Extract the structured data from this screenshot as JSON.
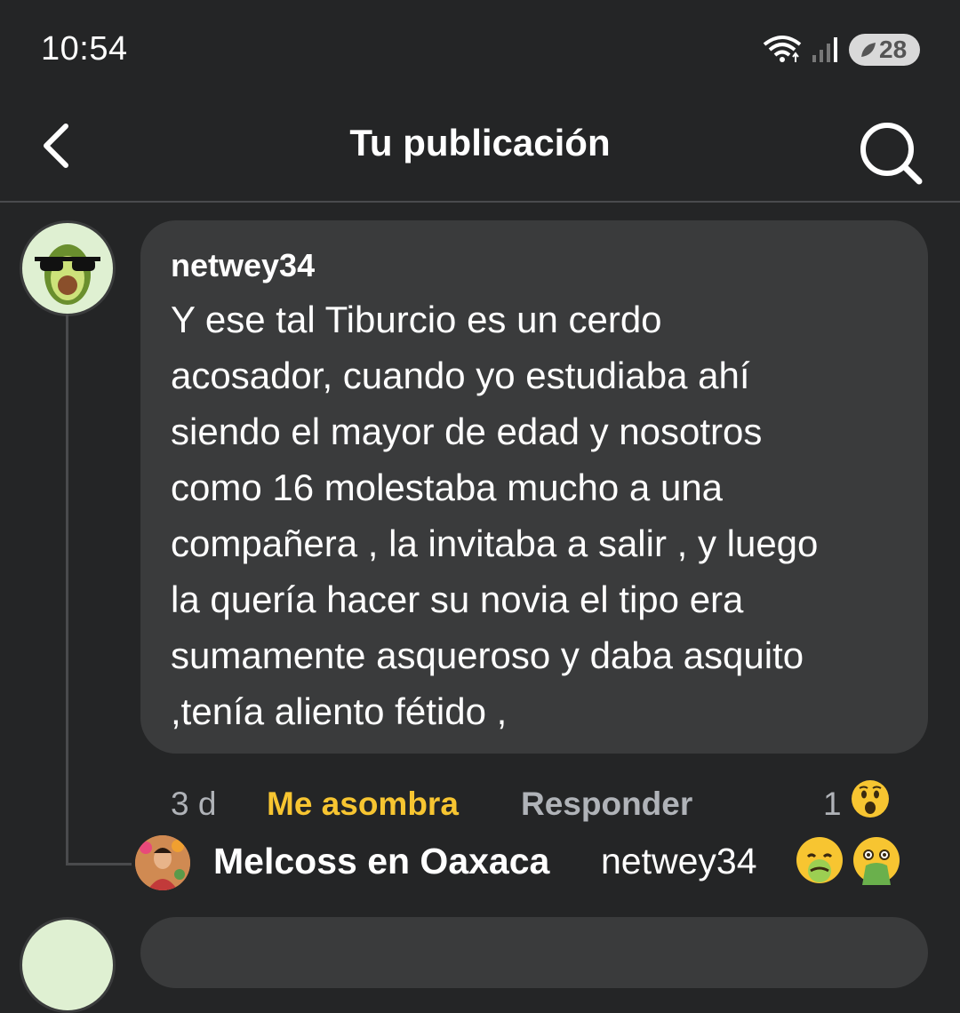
{
  "status_bar": {
    "time": "10:54",
    "battery": "28"
  },
  "header": {
    "title": "Tu publicación"
  },
  "comment": {
    "username": "netwey34",
    "text": "Y ese tal Tiburcio es un cerdo\nacosador, cuando yo estudiaba ahí\nsiendo el mayor de edad   y nosotros\ncomo 16 molestaba mucho a una\ncompañera , la invitaba a salir , y luego\nla quería hacer su novia el tipo era\nsumamente asqueroso y daba asquito\n,tenía aliento fétido ,",
    "time_ago": "3 d",
    "reaction_label": "Me asombra",
    "reply_label": "Responder",
    "reaction_count": "1",
    "reaction_icon": "wow-emoji"
  },
  "reply": {
    "author": "Melcoss en Oaxaca",
    "mention": "netwey34",
    "emojis": [
      "nauseated-face-emoji",
      "vomiting-face-emoji"
    ]
  },
  "colors": {
    "background": "#242526",
    "bubble": "#3a3b3c",
    "accent_reaction": "#f7c531",
    "muted": "#b0b3b8"
  }
}
